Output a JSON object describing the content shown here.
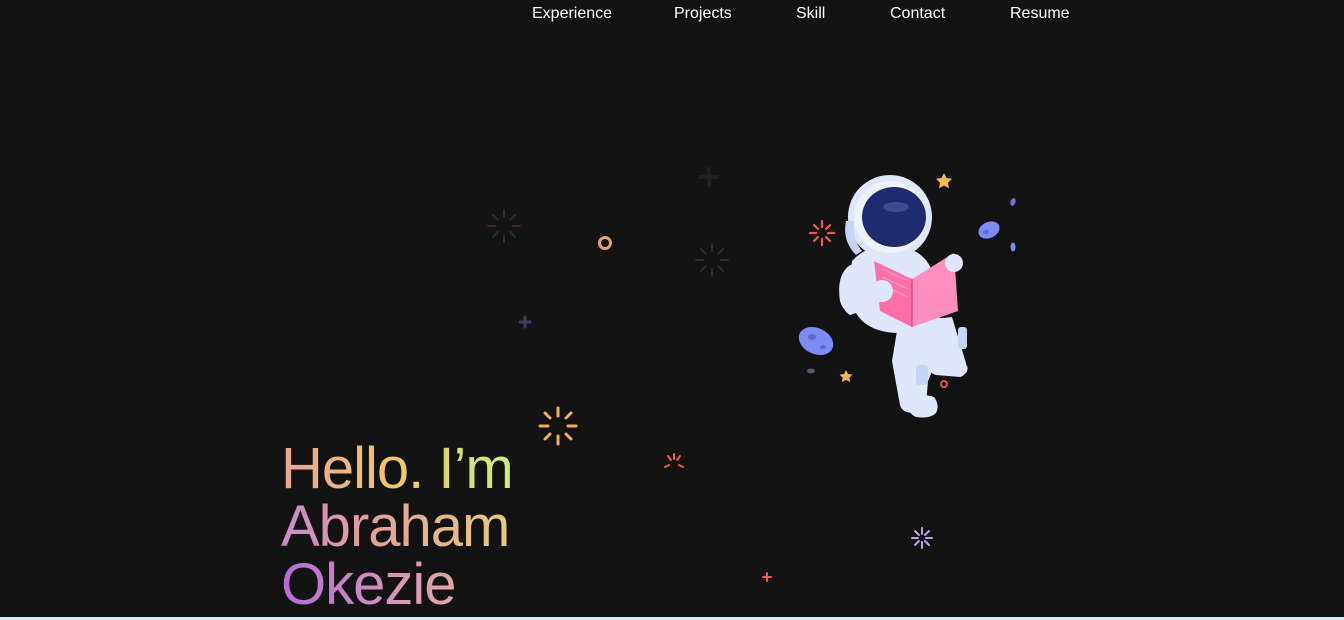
{
  "nav": {
    "items": [
      {
        "label": "Experience"
      },
      {
        "label": "Projects"
      },
      {
        "label": "Skill"
      },
      {
        "label": "Contact"
      },
      {
        "label": "Resume"
      }
    ]
  },
  "hero": {
    "line1": "Hello. I’m",
    "line2": "Abraham",
    "line3": "Okezie"
  },
  "colors": {
    "background": "#121212",
    "nav_text": "#ffffff",
    "gradient_pink": "#e8a49a",
    "gradient_yellow": "#f2c36a",
    "gradient_green": "#c8f07a",
    "gradient_purple": "#b56ad8",
    "astronaut_suit": "#dfe8fb",
    "astronaut_visor": "#1e2b6e",
    "book": "#ff7eb3"
  },
  "illustration": {
    "name": "astronaut-reading-book",
    "decorations": [
      "sparkle-icon",
      "star-icon",
      "ring-icon",
      "plus-icon",
      "asteroid-icon"
    ]
  }
}
